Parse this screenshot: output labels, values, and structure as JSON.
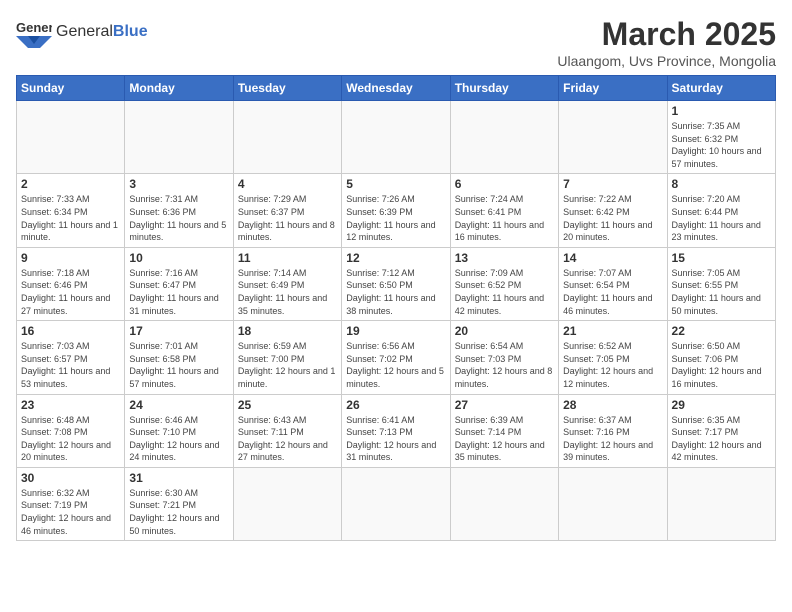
{
  "header": {
    "logo_general": "General",
    "logo_blue": "Blue",
    "title": "March 2025",
    "location": "Ulaangom, Uvs Province, Mongolia"
  },
  "weekdays": [
    "Sunday",
    "Monday",
    "Tuesday",
    "Wednesday",
    "Thursday",
    "Friday",
    "Saturday"
  ],
  "weeks": [
    [
      {
        "day": "",
        "info": ""
      },
      {
        "day": "",
        "info": ""
      },
      {
        "day": "",
        "info": ""
      },
      {
        "day": "",
        "info": ""
      },
      {
        "day": "",
        "info": ""
      },
      {
        "day": "",
        "info": ""
      },
      {
        "day": "1",
        "info": "Sunrise: 7:35 AM\nSunset: 6:32 PM\nDaylight: 10 hours\nand 57 minutes."
      }
    ],
    [
      {
        "day": "2",
        "info": "Sunrise: 7:33 AM\nSunset: 6:34 PM\nDaylight: 11 hours\nand 1 minute."
      },
      {
        "day": "3",
        "info": "Sunrise: 7:31 AM\nSunset: 6:36 PM\nDaylight: 11 hours\nand 5 minutes."
      },
      {
        "day": "4",
        "info": "Sunrise: 7:29 AM\nSunset: 6:37 PM\nDaylight: 11 hours\nand 8 minutes."
      },
      {
        "day": "5",
        "info": "Sunrise: 7:26 AM\nSunset: 6:39 PM\nDaylight: 11 hours\nand 12 minutes."
      },
      {
        "day": "6",
        "info": "Sunrise: 7:24 AM\nSunset: 6:41 PM\nDaylight: 11 hours\nand 16 minutes."
      },
      {
        "day": "7",
        "info": "Sunrise: 7:22 AM\nSunset: 6:42 PM\nDaylight: 11 hours\nand 20 minutes."
      },
      {
        "day": "8",
        "info": "Sunrise: 7:20 AM\nSunset: 6:44 PM\nDaylight: 11 hours\nand 23 minutes."
      }
    ],
    [
      {
        "day": "9",
        "info": "Sunrise: 7:18 AM\nSunset: 6:46 PM\nDaylight: 11 hours\nand 27 minutes."
      },
      {
        "day": "10",
        "info": "Sunrise: 7:16 AM\nSunset: 6:47 PM\nDaylight: 11 hours\nand 31 minutes."
      },
      {
        "day": "11",
        "info": "Sunrise: 7:14 AM\nSunset: 6:49 PM\nDaylight: 11 hours\nand 35 minutes."
      },
      {
        "day": "12",
        "info": "Sunrise: 7:12 AM\nSunset: 6:50 PM\nDaylight: 11 hours\nand 38 minutes."
      },
      {
        "day": "13",
        "info": "Sunrise: 7:09 AM\nSunset: 6:52 PM\nDaylight: 11 hours\nand 42 minutes."
      },
      {
        "day": "14",
        "info": "Sunrise: 7:07 AM\nSunset: 6:54 PM\nDaylight: 11 hours\nand 46 minutes."
      },
      {
        "day": "15",
        "info": "Sunrise: 7:05 AM\nSunset: 6:55 PM\nDaylight: 11 hours\nand 50 minutes."
      }
    ],
    [
      {
        "day": "16",
        "info": "Sunrise: 7:03 AM\nSunset: 6:57 PM\nDaylight: 11 hours\nand 53 minutes."
      },
      {
        "day": "17",
        "info": "Sunrise: 7:01 AM\nSunset: 6:58 PM\nDaylight: 11 hours\nand 57 minutes."
      },
      {
        "day": "18",
        "info": "Sunrise: 6:59 AM\nSunset: 7:00 PM\nDaylight: 12 hours\nand 1 minute."
      },
      {
        "day": "19",
        "info": "Sunrise: 6:56 AM\nSunset: 7:02 PM\nDaylight: 12 hours\nand 5 minutes."
      },
      {
        "day": "20",
        "info": "Sunrise: 6:54 AM\nSunset: 7:03 PM\nDaylight: 12 hours\nand 8 minutes."
      },
      {
        "day": "21",
        "info": "Sunrise: 6:52 AM\nSunset: 7:05 PM\nDaylight: 12 hours\nand 12 minutes."
      },
      {
        "day": "22",
        "info": "Sunrise: 6:50 AM\nSunset: 7:06 PM\nDaylight: 12 hours\nand 16 minutes."
      }
    ],
    [
      {
        "day": "23",
        "info": "Sunrise: 6:48 AM\nSunset: 7:08 PM\nDaylight: 12 hours\nand 20 minutes."
      },
      {
        "day": "24",
        "info": "Sunrise: 6:46 AM\nSunset: 7:10 PM\nDaylight: 12 hours\nand 24 minutes."
      },
      {
        "day": "25",
        "info": "Sunrise: 6:43 AM\nSunset: 7:11 PM\nDaylight: 12 hours\nand 27 minutes."
      },
      {
        "day": "26",
        "info": "Sunrise: 6:41 AM\nSunset: 7:13 PM\nDaylight: 12 hours\nand 31 minutes."
      },
      {
        "day": "27",
        "info": "Sunrise: 6:39 AM\nSunset: 7:14 PM\nDaylight: 12 hours\nand 35 minutes."
      },
      {
        "day": "28",
        "info": "Sunrise: 6:37 AM\nSunset: 7:16 PM\nDaylight: 12 hours\nand 39 minutes."
      },
      {
        "day": "29",
        "info": "Sunrise: 6:35 AM\nSunset: 7:17 PM\nDaylight: 12 hours\nand 42 minutes."
      }
    ],
    [
      {
        "day": "30",
        "info": "Sunrise: 6:32 AM\nSunset: 7:19 PM\nDaylight: 12 hours\nand 46 minutes."
      },
      {
        "day": "31",
        "info": "Sunrise: 6:30 AM\nSunset: 7:21 PM\nDaylight: 12 hours\nand 50 minutes."
      },
      {
        "day": "",
        "info": ""
      },
      {
        "day": "",
        "info": ""
      },
      {
        "day": "",
        "info": ""
      },
      {
        "day": "",
        "info": ""
      },
      {
        "day": "",
        "info": ""
      }
    ]
  ]
}
